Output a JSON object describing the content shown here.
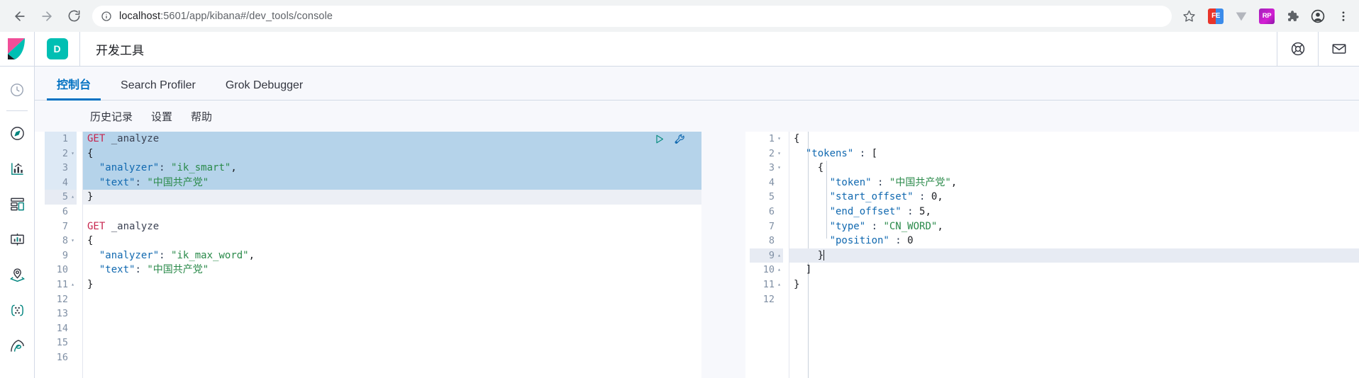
{
  "browser": {
    "back_icon": "arrow-left-icon",
    "forward_icon": "arrow-right-icon",
    "reload_icon": "reload-icon",
    "site_info_icon": "info-circle-icon",
    "url_host": "localhost",
    "url_rest": ":5601/app/kibana#/dev_tools/console",
    "bookmark_icon": "star-icon",
    "extensions": [
      {
        "name": "fe-extension-icon",
        "label": "FE"
      },
      {
        "name": "v-extension-icon",
        "label": "V"
      },
      {
        "name": "rp-extension-icon",
        "label": "RP"
      },
      {
        "name": "puzzle-extensions-icon",
        "label": ""
      },
      {
        "name": "profile-avatar-icon",
        "label": ""
      },
      {
        "name": "browser-menu-icon",
        "label": ""
      }
    ]
  },
  "kibana_header": {
    "logo_icon": "kibana-logo-icon",
    "space_badge": "D",
    "title": "开发工具",
    "help_icon": "life-ring-help-icon",
    "mail_icon": "envelope-newsfeed-icon"
  },
  "sidebar": {
    "items": [
      {
        "name": "sidebar-item-recent",
        "icon": "clock-icon"
      },
      {
        "name": "sidebar-item-discover",
        "icon": "compass-icon"
      },
      {
        "name": "sidebar-item-visualize",
        "icon": "line-chart-icon"
      },
      {
        "name": "sidebar-item-dashboard",
        "icon": "dashboard-grid-icon"
      },
      {
        "name": "sidebar-item-canvas",
        "icon": "presentation-icon"
      },
      {
        "name": "sidebar-item-maps",
        "icon": "map-pin-icon"
      },
      {
        "name": "sidebar-item-machine-learning",
        "icon": "ml-dots-icon"
      },
      {
        "name": "sidebar-item-apm",
        "icon": "apm-user-icon"
      }
    ]
  },
  "tabs": [
    {
      "label": "控制台",
      "active": true
    },
    {
      "label": "Search Profiler",
      "active": false
    },
    {
      "label": "Grok Debugger",
      "active": false
    }
  ],
  "submenu": [
    {
      "label": "历史记录"
    },
    {
      "label": "设置"
    },
    {
      "label": "帮助"
    }
  ],
  "editor": {
    "play_icon": "play-send-request-icon",
    "wrench_icon": "wrench-actions-icon",
    "request_lines": [
      {
        "n": 1,
        "fold": "",
        "text": "GET _analyze",
        "hl": "sel"
      },
      {
        "n": 2,
        "fold": "▾",
        "text": "{",
        "hl": "sel"
      },
      {
        "n": 3,
        "fold": "",
        "text": "  \"analyzer\": \"ik_smart\",",
        "hl": "sel"
      },
      {
        "n": 4,
        "fold": "",
        "text": "  \"text\": \"中国共产党\"",
        "hl": "sel"
      },
      {
        "n": 5,
        "fold": "▴",
        "text": "}",
        "hl": "act"
      },
      {
        "n": 6,
        "fold": "",
        "text": "",
        "hl": ""
      },
      {
        "n": 7,
        "fold": "",
        "text": "GET _analyze",
        "hl": ""
      },
      {
        "n": 8,
        "fold": "▾",
        "text": "{",
        "hl": ""
      },
      {
        "n": 9,
        "fold": "",
        "text": "  \"analyzer\": \"ik_max_word\",",
        "hl": ""
      },
      {
        "n": 10,
        "fold": "",
        "text": "  \"text\": \"中国共产党\"",
        "hl": ""
      },
      {
        "n": 11,
        "fold": "▴",
        "text": "}",
        "hl": ""
      },
      {
        "n": 12,
        "fold": "",
        "text": "",
        "hl": ""
      },
      {
        "n": 13,
        "fold": "",
        "text": "",
        "hl": ""
      },
      {
        "n": 14,
        "fold": "",
        "text": "",
        "hl": ""
      },
      {
        "n": 15,
        "fold": "",
        "text": "",
        "hl": ""
      },
      {
        "n": 16,
        "fold": "",
        "text": "",
        "hl": ""
      }
    ],
    "response_lines": [
      {
        "n": 1,
        "fold": "▾",
        "text": "{",
        "hl": ""
      },
      {
        "n": 2,
        "fold": "▾",
        "text": "  \"tokens\" : [",
        "hl": ""
      },
      {
        "n": 3,
        "fold": "▾",
        "text": "    {",
        "hl": ""
      },
      {
        "n": 4,
        "fold": "",
        "text": "      \"token\" : \"中国共产党\",",
        "hl": ""
      },
      {
        "n": 5,
        "fold": "",
        "text": "      \"start_offset\" : 0,",
        "hl": ""
      },
      {
        "n": 6,
        "fold": "",
        "text": "      \"end_offset\" : 5,",
        "hl": ""
      },
      {
        "n": 7,
        "fold": "",
        "text": "      \"type\" : \"CN_WORD\",",
        "hl": ""
      },
      {
        "n": 8,
        "fold": "",
        "text": "      \"position\" : 0",
        "hl": ""
      },
      {
        "n": 9,
        "fold": "▴",
        "text": "    }",
        "hl": "act-out"
      },
      {
        "n": 10,
        "fold": "▴",
        "text": "  ]",
        "hl": ""
      },
      {
        "n": 11,
        "fold": "▴",
        "text": "}",
        "hl": ""
      },
      {
        "n": 12,
        "fold": "",
        "text": "",
        "hl": ""
      }
    ]
  },
  "colors": {
    "accent_blue": "#0071c2",
    "kibana_teal": "#00bfb3",
    "kibana_pink": "#f04e98",
    "method_red": "#c7254e",
    "json_key_blue": "#1169b0",
    "json_string_green": "#2a8a4a",
    "selection_blue": "#b5d3ea"
  }
}
